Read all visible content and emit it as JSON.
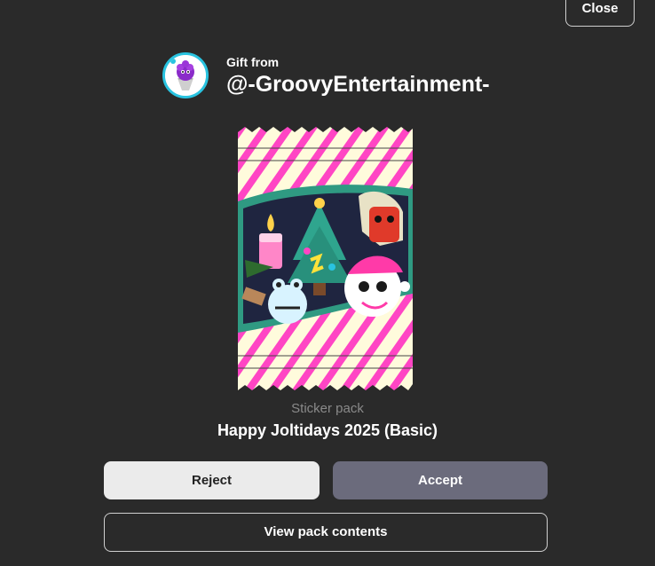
{
  "header": {
    "close_label": "Close"
  },
  "gift": {
    "label": "Gift from",
    "username": "@-GroovyEntertainment-"
  },
  "pack": {
    "type_label": "Sticker pack",
    "name": "Happy Joltidays 2025 (Basic)"
  },
  "actions": {
    "reject_label": "Reject",
    "accept_label": "Accept",
    "view_label": "View pack contents"
  },
  "colors": {
    "background": "#2a2a2a",
    "avatar_ring": "#29c3e0",
    "reject_bg": "#ebebeb",
    "accept_bg": "#6b6b7c",
    "wrapper_cream": "#fffbdc",
    "wrapper_stripe": "#ff45c4",
    "window_ring": "#2f9a82"
  },
  "icons": {
    "avatar": "snow-cone-avatar-icon",
    "pack_art": "christmas-sticker-pack-illustration"
  }
}
